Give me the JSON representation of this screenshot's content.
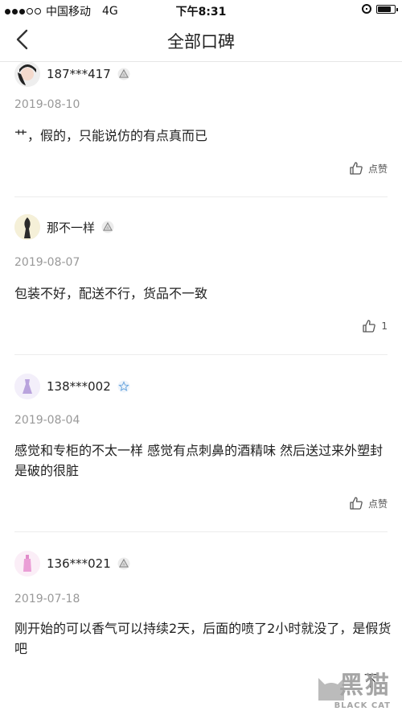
{
  "status_bar": {
    "carrier": "中国移动",
    "network": "4G",
    "time": "下午8:31",
    "battery_level": 0.85
  },
  "header": {
    "title": "全部口碑"
  },
  "reviews": [
    {
      "user": "187***417",
      "date": "2019-08-10",
      "text": "艹，假的，只能说仿的有点真而已",
      "like_label": "点赞"
    },
    {
      "user": "那不一样",
      "date": "2019-08-07",
      "text": "包装不好，配送不行，货品不一致",
      "like_label": "1"
    },
    {
      "user": "138***002",
      "date": "2019-08-04",
      "text": "感觉和专柜的不太一样 感觉有点刺鼻的酒精味  然后送过来外塑封是破的很脏",
      "like_label": "点赞"
    },
    {
      "user": "136***021",
      "date": "2019-07-18",
      "text": "刚开始的可以香气可以持续2天，后面的喷了2小时就没了，是假货吧",
      "like_label": ""
    }
  ],
  "watermark": {
    "main": "黑猫",
    "sub": "BLACK CAT"
  },
  "colors": {
    "date": "#999999",
    "separator": "#ececec",
    "text": "#222222"
  }
}
